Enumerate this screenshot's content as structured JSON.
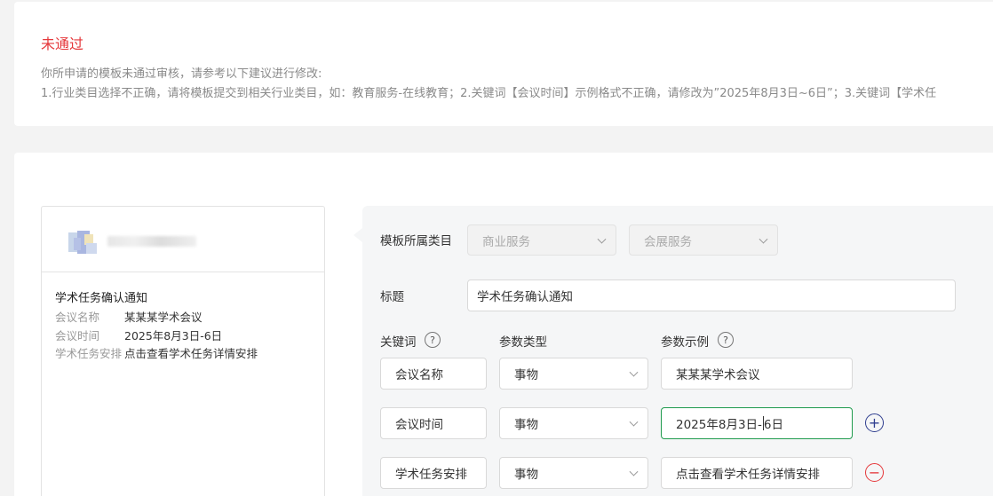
{
  "status": {
    "title": "未通过",
    "description": "你所申请的模板未通过审核，请参考以下建议进行修改:",
    "detail": "1.行业类目选择不正确，请将模板提交到相关行业类目，如：教育服务-在线教育；2.关键词【会议时间】示例格式不正确，请修改为”2025年8月3日~6日”；3.关键词【学术任"
  },
  "preview": {
    "title": "学术任务确认通知",
    "rows": [
      {
        "key": "会议名称",
        "value": "某某某学术会议"
      },
      {
        "key": "会议时间",
        "value": "2025年8月3日-6日"
      },
      {
        "key": "学术任务安排",
        "value": "点击查看学术任务详情安排"
      }
    ]
  },
  "form": {
    "category_label": "模板所属类目",
    "category_primary": "商业服务",
    "category_secondary": "会展服务",
    "title_label": "标题",
    "title_value": "学术任务确认通知",
    "keyword_header": "关键词",
    "param_type_header": "参数类型",
    "param_example_header": "参数示例",
    "help_icon_glyph": "?",
    "add_icon_glyph": "+",
    "remove_icon_glyph": "−",
    "params": [
      {
        "keyword": "会议名称",
        "type": "事物",
        "example": "某某某学术会议"
      },
      {
        "keyword": "会议时间",
        "type": "事物",
        "example_before_caret": "2025年8月3日-",
        "example_after_caret": "6日"
      },
      {
        "keyword": "学术任务安排",
        "type": "事物",
        "example": "点击查看学术任务详情安排"
      }
    ]
  },
  "colors": {
    "error": "#e5383b",
    "focus": "#1f9a4d",
    "add": "#2f3e8f"
  }
}
